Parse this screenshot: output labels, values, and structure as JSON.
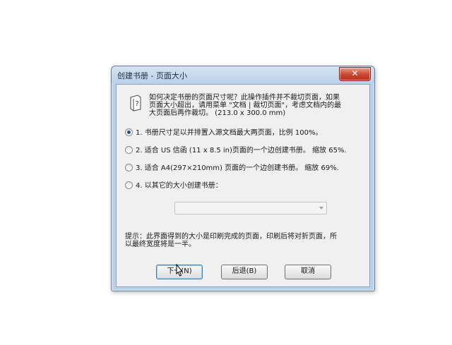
{
  "window": {
    "title": "创建书册 - 页面大小",
    "close_label": "✕"
  },
  "question": {
    "lines": [
      "如何决定书册的页面尺寸呢？此操作插件并不裁切页面，如果",
      "页面大小超出，请用菜单 \"文档 | 裁切页面\"，考虑文档内的最",
      "大页面后再作裁切。 (213.0 x 300.0 mm)"
    ]
  },
  "options": [
    {
      "label": "1. 书册尺寸足以并排置入源文档最大两页面，比例 100%。",
      "checked": true
    },
    {
      "label": "2. 适合 US 信函 (11 x 8.5 in)页面的一个边创建书册。 缩放 65%.",
      "checked": false
    },
    {
      "label": "3. 适合 A4(297×210mm) 页面的一个边创建书册。 缩放 69%.",
      "checked": false
    },
    {
      "label": "4. 以其它的大小创建书册：",
      "checked": false
    }
  ],
  "size_select": {
    "value": ""
  },
  "hint": {
    "lines": [
      "提示：此界面得到的大小是印刷完成的页面，印刷后将对折页面，所",
      "以最终宽度将是一半。"
    ]
  },
  "buttons": {
    "next": "下一(N)",
    "back": "后退(B)",
    "cancel": "取消"
  },
  "icons": {
    "help": "help-book-icon",
    "close": "close-icon",
    "cursor": "mouse-pointer-icon"
  }
}
